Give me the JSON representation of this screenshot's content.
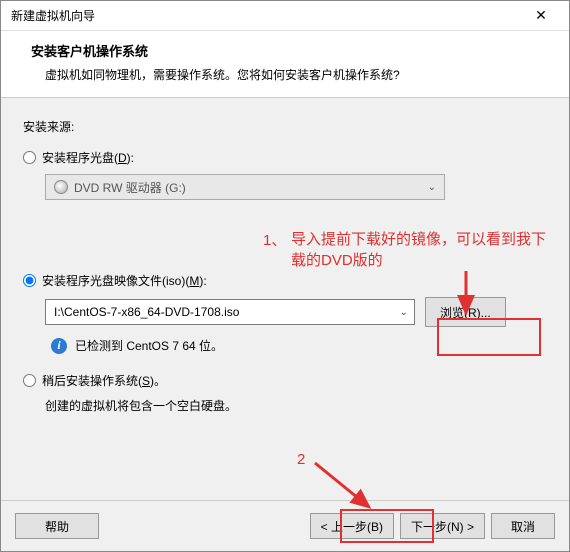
{
  "window": {
    "title": "新建虚拟机向导",
    "close": "✕"
  },
  "header": {
    "title": "安装客户机操作系统",
    "subtitle": "虚拟机如同物理机，需要操作系统。您将如何安装客户机操作系统?"
  },
  "source": {
    "label": "安装来源:",
    "opt_disc": "安装程序光盘(",
    "opt_disc_u": "D",
    "opt_disc_end": "):",
    "disc_drive": "DVD RW 驱动器 (G:)",
    "opt_iso": "安装程序光盘映像文件(iso)(",
    "opt_iso_u": "M",
    "opt_iso_end": "):",
    "iso_path": "I:\\CentOS-7-x86_64-DVD-1708.iso",
    "browse": "浏览(R)...",
    "detected": "已检测到 CentOS 7 64 位。",
    "opt_later": "稍后安装操作系统(",
    "opt_later_u": "S",
    "opt_later_end": ")。",
    "later_desc": "创建的虚拟机将包含一个空白硬盘。"
  },
  "buttons": {
    "help": "帮助",
    "back": "< 上一步(B)",
    "next": "下一步(N) >",
    "cancel": "取消"
  },
  "annotations": {
    "num1": "1、",
    "text1": "导入提前下载好的镜像，可以看到我下载的DVD版的",
    "num2": "2"
  },
  "info_glyph": "i",
  "chevron": "⌄"
}
